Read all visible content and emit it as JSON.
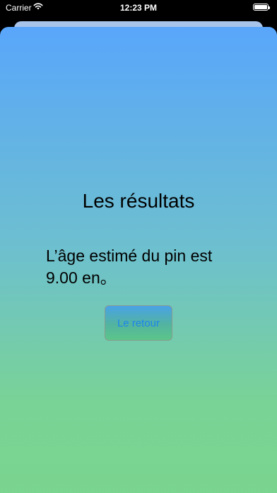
{
  "status_bar": {
    "carrier": "Carrier",
    "wifi_icon": "wifi-icon",
    "time": "12:23 PM",
    "battery_icon": "battery-icon"
  },
  "results": {
    "title": "Les résultats",
    "message": "L’âge estimé du pin est 9.00 en。",
    "back_button_label": "Le retour"
  },
  "colors": {
    "gradient_top": "#59a6fb",
    "gradient_bottom": "#7ad58e",
    "button_text": "#1f86ea"
  }
}
